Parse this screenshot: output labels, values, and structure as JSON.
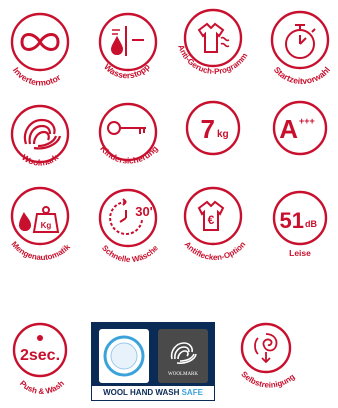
{
  "colors": {
    "accent": "#c8102e",
    "wool_navy": "#0b2b57",
    "wool_blue": "#3ba3dc"
  },
  "features": [
    {
      "label": "Invertermotor",
      "icon": "infinity-icon"
    },
    {
      "label": "Wasserstopp",
      "icon": "water-drop-icon"
    },
    {
      "label": "Anti-Geruch-Programm",
      "icon": "shirt-odor-icon"
    },
    {
      "label": "Startzeitvorwahl",
      "icon": "stopwatch-icon"
    },
    {
      "label": "Woolmark",
      "icon": "wool-ball-icon"
    },
    {
      "label": "Kindersicherung",
      "icon": "key-icon"
    },
    {
      "label": "7",
      "icon": "capacity-icon",
      "unit": "kg"
    },
    {
      "label": "A",
      "icon": "energy-class-icon",
      "sup": "+++"
    },
    {
      "label": "Mengenautomatik",
      "icon": "weight-icon",
      "weight": "Kg"
    },
    {
      "label": "Schnelle Wäsche",
      "icon": "timer-30-icon",
      "timer": "30'"
    },
    {
      "label": "Antiflecken-Option",
      "icon": "stain-shirt-icon"
    },
    {
      "label": "Leise",
      "icon": "noise-level-icon",
      "value": "51",
      "unit": "dB"
    },
    {
      "label": "Push & Wash",
      "icon": "push-wash-icon",
      "value": "2sec."
    },
    {
      "label": "Selbstreinigung",
      "icon": "self-clean-icon"
    }
  ],
  "wool_badge": {
    "brand": "WOOLMARK",
    "text": "WOOL HAND WASH",
    "safe": "SAFE"
  }
}
